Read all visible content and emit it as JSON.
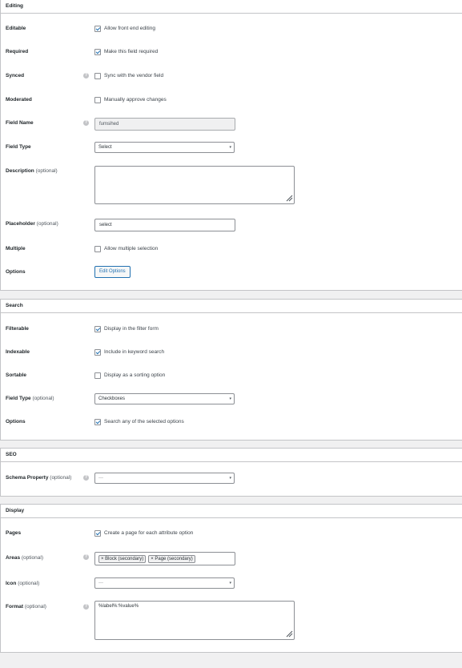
{
  "editing": {
    "title": "Editing",
    "editable": {
      "label": "Editable",
      "checkbox": "Allow front end editing",
      "checked": true
    },
    "required": {
      "label": "Required",
      "checkbox": "Make this field required",
      "checked": true
    },
    "synced": {
      "label": "Synced",
      "checkbox": "Sync with the vendor field",
      "checked": false
    },
    "moderated": {
      "label": "Moderated",
      "checkbox": "Manually approve changes",
      "checked": false
    },
    "field_name": {
      "label": "Field Name",
      "value": "fumsihed"
    },
    "field_type": {
      "label": "Field Type",
      "value": "Select"
    },
    "description": {
      "label": "Description",
      "optional": "(optional)",
      "value": ""
    },
    "placeholder": {
      "label": "Placeholder",
      "optional": "(optional)",
      "value": "select"
    },
    "multiple": {
      "label": "Multiple",
      "checkbox": "Allow multiple selection",
      "checked": false
    },
    "options": {
      "label": "Options",
      "button": "Edit Options"
    }
  },
  "search": {
    "title": "Search",
    "filterable": {
      "label": "Filterable",
      "checkbox": "Display in the filter form",
      "checked": true
    },
    "indexable": {
      "label": "Indexable",
      "checkbox": "Include in keyword search",
      "checked": true
    },
    "sortable": {
      "label": "Sortable",
      "checkbox": "Display as a sorting option",
      "checked": false
    },
    "field_type": {
      "label": "Field Type",
      "optional": "(optional)",
      "value": "Checkboxes"
    },
    "options": {
      "label": "Options",
      "checkbox": "Search any of the selected options",
      "checked": true
    }
  },
  "seo": {
    "title": "SEO",
    "schema_property": {
      "label": "Schema Property",
      "optional": "(optional)",
      "value": "—"
    }
  },
  "display": {
    "title": "Display",
    "pages": {
      "label": "Pages",
      "checkbox": "Create a page for each attribute option",
      "checked": true
    },
    "areas": {
      "label": "Areas",
      "optional": "(optional)",
      "tags": [
        "× Block (secondary)",
        "× Page (secondary)"
      ]
    },
    "icon": {
      "label": "Icon",
      "optional": "(optional)",
      "value": "—"
    },
    "format": {
      "label": "Format",
      "optional": "(optional)",
      "value": "%label%:%value%"
    }
  }
}
